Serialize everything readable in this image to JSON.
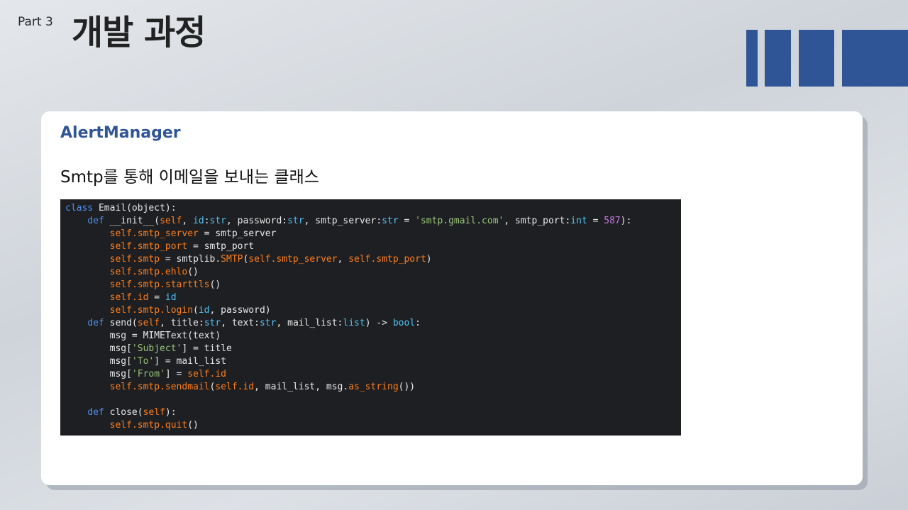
{
  "header": {
    "part": "Part 3",
    "title": "개발 과정",
    "decoration_color": "#2f5597"
  },
  "card": {
    "title": "AlertManager",
    "subtitle": "Smtp를 통해 이메일을 보내는 클래스"
  },
  "code": {
    "language": "python",
    "lines": [
      [
        [
          "kw",
          "class"
        ],
        [
          "d",
          " Email"
        ],
        [
          "d",
          "(object):"
        ]
      ],
      [
        [
          "d",
          "    "
        ],
        [
          "kw",
          "def"
        ],
        [
          "d",
          " __init__("
        ],
        [
          "self",
          "self"
        ],
        [
          "d",
          ", "
        ],
        [
          "type",
          "id"
        ],
        [
          "d",
          ":"
        ],
        [
          "type",
          "str"
        ],
        [
          "d",
          ", password:"
        ],
        [
          "type",
          "str"
        ],
        [
          "d",
          ", smtp_server:"
        ],
        [
          "type",
          "str"
        ],
        [
          "d",
          " = "
        ],
        [
          "str",
          "'smtp.gmail.com'"
        ],
        [
          "d",
          ", smtp_port:"
        ],
        [
          "type",
          "int"
        ],
        [
          "d",
          " = "
        ],
        [
          "num",
          "587"
        ],
        [
          "d",
          "):"
        ]
      ],
      [
        [
          "d",
          "        "
        ],
        [
          "self",
          "self"
        ],
        [
          "self",
          ".smtp_server"
        ],
        [
          "d",
          " = smtp_server"
        ]
      ],
      [
        [
          "d",
          "        "
        ],
        [
          "self",
          "self"
        ],
        [
          "self",
          ".smtp_port"
        ],
        [
          "d",
          " = smtp_port"
        ]
      ],
      [
        [
          "d",
          "        "
        ],
        [
          "self",
          "self"
        ],
        [
          "self",
          ".smtp"
        ],
        [
          "d",
          " = smtplib."
        ],
        [
          "self",
          "SMTP"
        ],
        [
          "d",
          "("
        ],
        [
          "self",
          "self"
        ],
        [
          "self",
          ".smtp_server"
        ],
        [
          "d",
          ", "
        ],
        [
          "self",
          "self"
        ],
        [
          "self",
          ".smtp_port"
        ],
        [
          "d",
          ")"
        ]
      ],
      [
        [
          "d",
          "        "
        ],
        [
          "self",
          "self"
        ],
        [
          "self",
          ".smtp.ehlo"
        ],
        [
          "d",
          "()"
        ]
      ],
      [
        [
          "d",
          "        "
        ],
        [
          "self",
          "self"
        ],
        [
          "self",
          ".smtp.starttls"
        ],
        [
          "d",
          "()"
        ]
      ],
      [
        [
          "d",
          "        "
        ],
        [
          "self",
          "self"
        ],
        [
          "self",
          ".id"
        ],
        [
          "d",
          " = "
        ],
        [
          "type",
          "id"
        ]
      ],
      [
        [
          "d",
          "        "
        ],
        [
          "self",
          "self"
        ],
        [
          "self",
          ".smtp.login"
        ],
        [
          "d",
          "("
        ],
        [
          "type",
          "id"
        ],
        [
          "d",
          ", password)"
        ]
      ],
      [
        [
          "d",
          "    "
        ],
        [
          "kw",
          "def"
        ],
        [
          "d",
          " send("
        ],
        [
          "self",
          "self"
        ],
        [
          "d",
          ", title:"
        ],
        [
          "type",
          "str"
        ],
        [
          "d",
          ", text:"
        ],
        [
          "type",
          "str"
        ],
        [
          "d",
          ", mail_list:"
        ],
        [
          "type",
          "list"
        ],
        [
          "d",
          ") -> "
        ],
        [
          "type",
          "bool"
        ],
        [
          "d",
          ":"
        ]
      ],
      [
        [
          "d",
          "        msg = MIMEText(text)"
        ]
      ],
      [
        [
          "d",
          "        msg["
        ],
        [
          "str",
          "'Subject'"
        ],
        [
          "d",
          "] = title"
        ]
      ],
      [
        [
          "d",
          "        msg["
        ],
        [
          "str",
          "'To'"
        ],
        [
          "d",
          "] = mail_list"
        ]
      ],
      [
        [
          "d",
          "        msg["
        ],
        [
          "str",
          "'From'"
        ],
        [
          "d",
          "] = "
        ],
        [
          "self",
          "self"
        ],
        [
          "self",
          ".id"
        ]
      ],
      [
        [
          "d",
          "        "
        ],
        [
          "self",
          "self"
        ],
        [
          "self",
          ".smtp.sendmail"
        ],
        [
          "d",
          "("
        ],
        [
          "self",
          "self"
        ],
        [
          "self",
          ".id"
        ],
        [
          "d",
          ", mail_list, msg."
        ],
        [
          "self",
          "as_string"
        ],
        [
          "d",
          "())"
        ]
      ],
      [
        [
          "d",
          ""
        ]
      ],
      [
        [
          "d",
          "    "
        ],
        [
          "kw",
          "def"
        ],
        [
          "d",
          " close("
        ],
        [
          "self",
          "self"
        ],
        [
          "d",
          "):"
        ]
      ],
      [
        [
          "d",
          "        "
        ],
        [
          "self",
          "self"
        ],
        [
          "self",
          ".smtp.quit"
        ],
        [
          "d",
          "()"
        ]
      ]
    ]
  }
}
